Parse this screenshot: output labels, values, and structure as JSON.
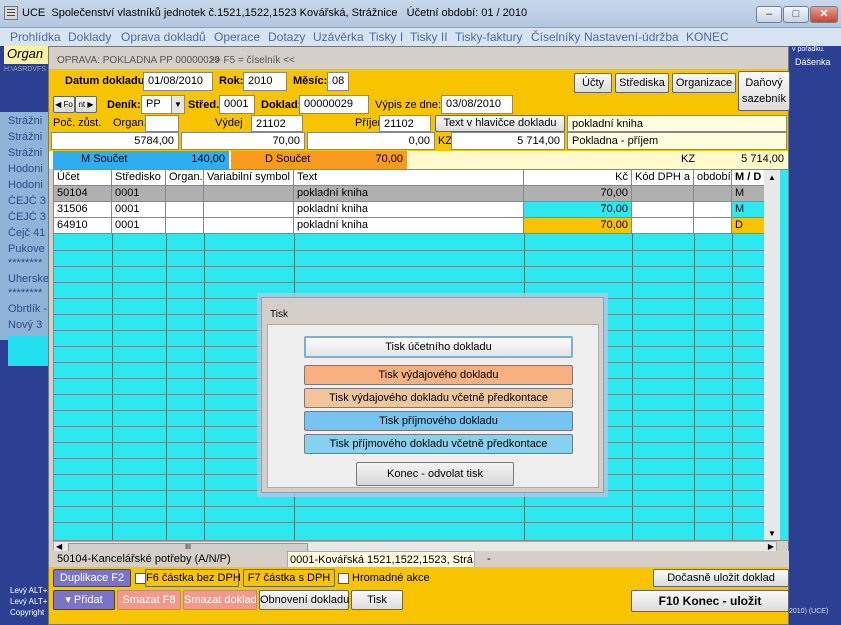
{
  "window": {
    "app": "UCE",
    "title": "Společenství vlastníků jednotek č.1521,1522,1523 Kovářská, Strážnice",
    "period_label": "Účetní období:",
    "period_value": "01 / 2010",
    "min": "–",
    "max": "□",
    "close": "✕"
  },
  "menu": [
    "Prohlídka",
    "Doklady",
    "Oprava dokladů",
    "Operace",
    "Dotazy",
    "Uzávěrka",
    "Tisky I",
    "Tisky II",
    "Tisky-faktury",
    "Číselníky",
    "Nastavení-údržba",
    "KONEC"
  ],
  "bg": {
    "organ": "Organ",
    "path": "H:\\ASRDVFS",
    "items": [
      "Strážni",
      "Strážni",
      "Strážni",
      "Hodoni",
      "Hodoni",
      "ČEJČ 3",
      "ČEJČ 3",
      "Čejč 41",
      "Pukove",
      "********",
      "Uherske",
      "********",
      "Obrtlík -",
      "Nový 3"
    ],
    "foot": [
      "Levý ALT+",
      "Levý ALT+",
      "Copyright"
    ],
    "right_small": "v pořadku.",
    "right_name": "Dášenka",
    "right_copy": "2010) (UCE)"
  },
  "form": {
    "title": "OPRAVA:  POKLADNA  PP 00000029",
    "hint": ">> F5 = číselník <<",
    "datum_label": "Datum dokladu:",
    "datum": "01/08/2010",
    "rok_label": "Rok:",
    "rok": "2010",
    "mesic_label": "Měsíc:",
    "mesic": "08",
    "btn_ucty": "Účty",
    "btn_strediska": "Střediska",
    "btn_organizace": "Organizace",
    "btn_sazebnik_1": "Daňový",
    "btn_sazebnik_2": "sazebník",
    "nav_prev": "◀ Fo",
    "nav_next": "nt ▶",
    "denik_label": "Deník:",
    "denik": "PP",
    "stred_label": "Střed.",
    "stred": "0001",
    "doklad_label": "Doklad:",
    "doklad": "00000029",
    "vypis_label": "Výpis ze dne:",
    "vypis": "03/08/2010",
    "poc_label": "Poč. zůst.",
    "organ_label": "Organ.",
    "poc_value": "5784,00",
    "vydej_label": "Výdej",
    "vydej_acct": "21102",
    "vydej_value": "70,00",
    "prijem_label": "Příjem",
    "prijem_acct": "21102",
    "prijem_value": "0,00",
    "kz_label": "KZ",
    "kz_value": "5 714,00",
    "text_header_btn": "Text v hlavičce dokladu",
    "text_header_1": "pokladní kniha",
    "text_header_2": "Pokladna - příjem",
    "m_label": "M  Součet",
    "m_value": "140,00",
    "d_label": "D  Součet",
    "d_value": "70,00",
    "kz2_label": "KZ",
    "kz2_value": "5 714,00"
  },
  "grid": {
    "headers": [
      "Účet",
      "Středisko",
      "Organ.",
      "Variabilní symbol",
      "Text",
      "Kč",
      "Kód DPH a",
      "období",
      "M / D"
    ],
    "rows": [
      {
        "ucet": "50104",
        "stredisko": "0001",
        "organ": "",
        "vs": "",
        "text": "pokladní kniha",
        "kc": "70,00",
        "dph": "",
        "obdobi": "",
        "md": "M"
      },
      {
        "ucet": "31506",
        "stredisko": "0001",
        "organ": "",
        "vs": "",
        "text": "pokladní kniha",
        "kc": "70,00",
        "dph": "",
        "obdobi": "",
        "md": "M"
      },
      {
        "ucet": "64910",
        "stredisko": "0001",
        "organ": "",
        "vs": "",
        "text": "pokladní kniha",
        "kc": "70,00",
        "dph": "",
        "obdobi": "",
        "md": "D"
      }
    ],
    "scroll_up": "▲",
    "scroll_down": "▼",
    "scroll_left": "◀",
    "scroll_right": "▶",
    "scroll_grip": "III"
  },
  "status": {
    "account": "50104-Kancelářské potřeby  (A/N/P)",
    "org": "0001-Kovářská 1521,1522,1523, Strá",
    "dash": "-"
  },
  "footer": {
    "duplikace": "Duplikace F2",
    "f6": "F6 částka bez DPH",
    "f7": "F7 částka s DPH",
    "hromadne": "Hromadné akce",
    "docasne": "Dočasně uložit doklad",
    "pridat": "▾ Přidat",
    "smazat_f8": "Smazat F8",
    "smazat_doklad": "Smazat doklad",
    "obnoveni": "Obnovení dokladu",
    "tisk": "Tisk",
    "f10": "F10  Konec - uložit"
  },
  "dialog": {
    "title": "Tisk",
    "buttons": [
      "Tisk účetního dokladu",
      "Tisk výdajového dokladu",
      "Tisk výdajového dokladu včetně předkontace",
      "Tisk příjmového dokladu",
      "Tisk příjmového dokladu včetně předkontace"
    ],
    "cancel": "Konec - odvolat tisk"
  },
  "colors": {
    "yellow": "#f8c400",
    "cyan": "#2ee8f0",
    "blue_sum": "#2eaef0",
    "orange_sum": "#f79a1e",
    "expense": "#f8b080",
    "expense_pre": "#f3c59b",
    "income": "#78c4f0",
    "income_pre": "#86d2ee"
  }
}
